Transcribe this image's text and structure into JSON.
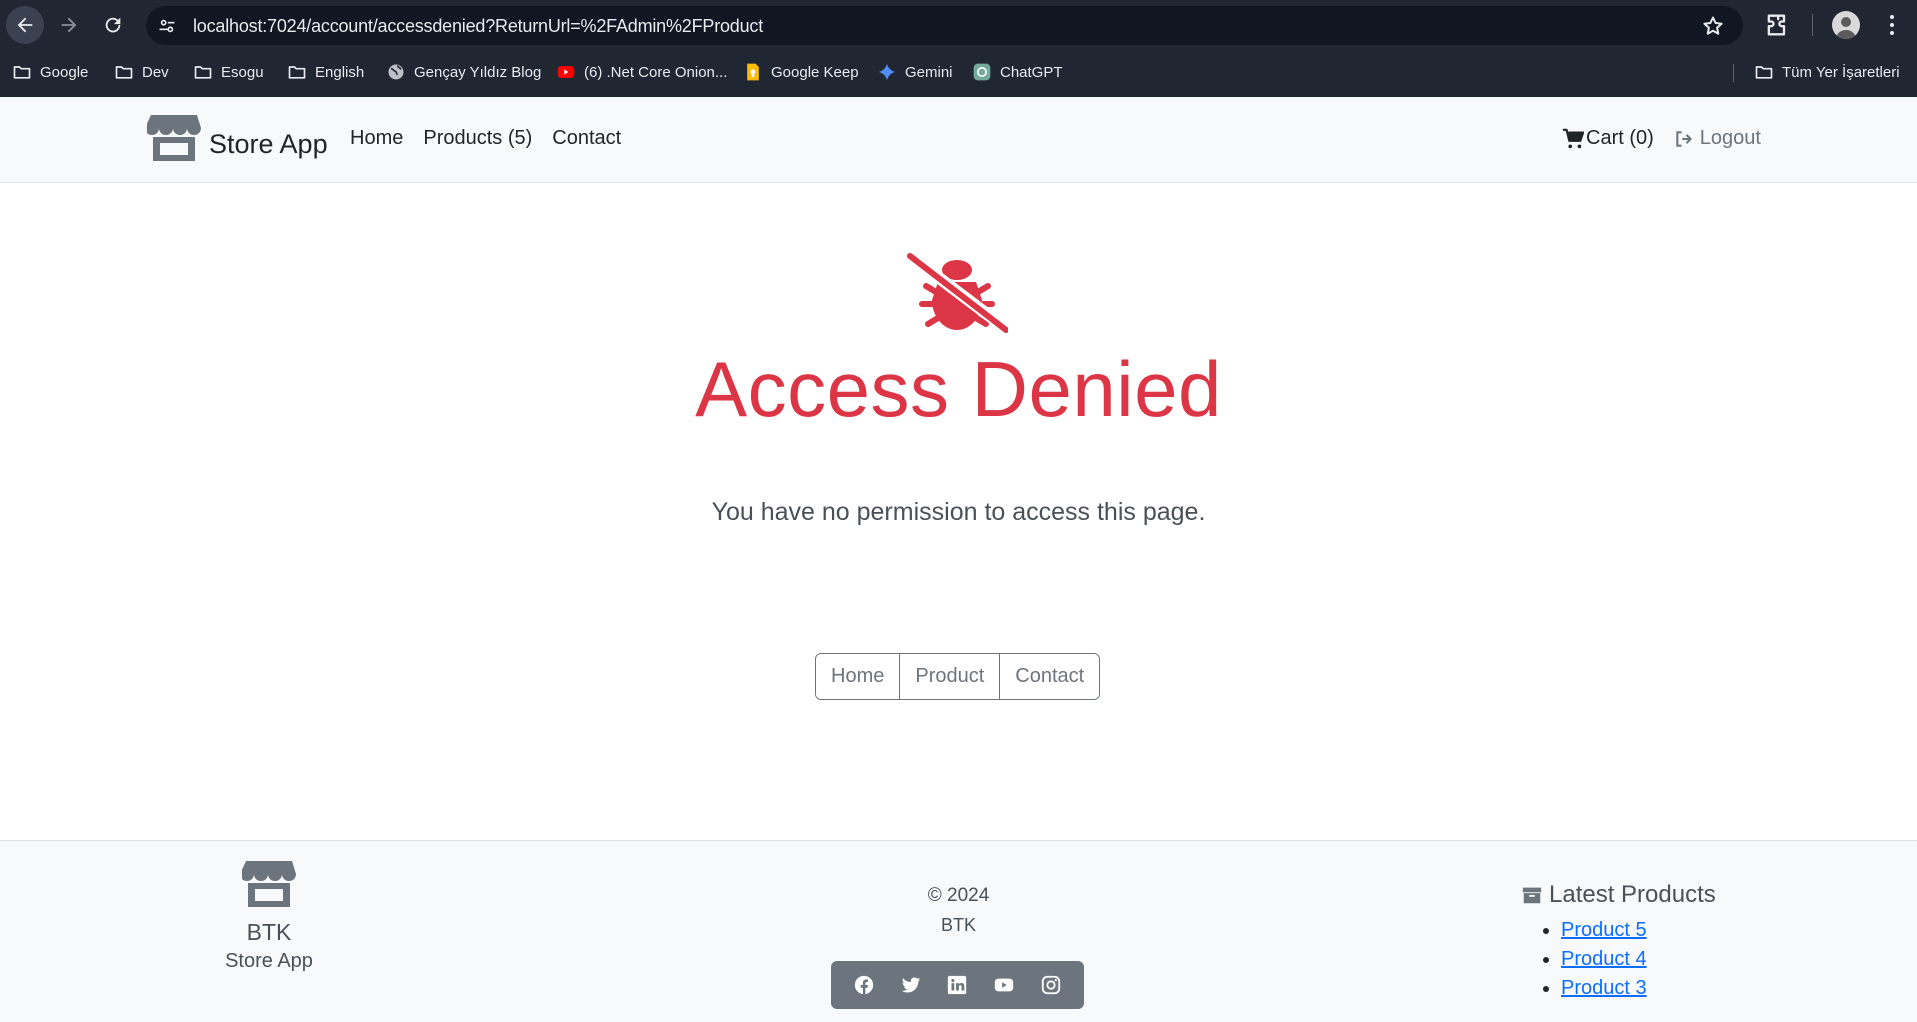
{
  "browser": {
    "url": "localhost:7024/account/accessdenied?ReturnUrl=%2FAdmin%2FProduct",
    "bookmarks": [
      {
        "label": "Google",
        "icon": "folder-icon"
      },
      {
        "label": "Dev",
        "icon": "folder-icon"
      },
      {
        "label": "Esogu",
        "icon": "folder-icon"
      },
      {
        "label": "English",
        "icon": "folder-icon"
      },
      {
        "label": "Gençay Yıldız Blog",
        "icon": "globe-icon"
      },
      {
        "label": "(6) .Net Core Onion...",
        "icon": "youtube-icon"
      },
      {
        "label": "Google Keep",
        "icon": "keep-icon"
      },
      {
        "label": "Gemini",
        "icon": "gemini-icon"
      },
      {
        "label": "ChatGPT",
        "icon": "chatgpt-icon"
      }
    ],
    "all_bookmarks_label": "Tüm Yer İşaretleri"
  },
  "navbar": {
    "brand": "Store App",
    "links": {
      "home": "Home",
      "products": "Products (5)",
      "contact": "Contact"
    },
    "cart": "Cart (0)",
    "logout": "Logout"
  },
  "main": {
    "title": "Access Denied",
    "message": "You have no permission to access this page.",
    "buttons": {
      "home": "Home",
      "product": "Product",
      "contact": "Contact"
    }
  },
  "footer": {
    "brand_title": "BTK",
    "brand_subtitle": "Store App",
    "copyright": "© 2024",
    "owner": "BTK",
    "latest_title": "Latest Products",
    "latest": [
      "Product 5",
      "Product 4",
      "Product 3"
    ],
    "social_icons": [
      "facebook-icon",
      "twitter-icon",
      "linkedin-icon",
      "youtube-icon",
      "instagram-icon"
    ]
  },
  "colors": {
    "chrome_bg": "#202632",
    "danger": "#dc3545",
    "navbar_bg": "#f8f9fa",
    "secondary": "#6c757d",
    "link": "#0d6efd"
  }
}
